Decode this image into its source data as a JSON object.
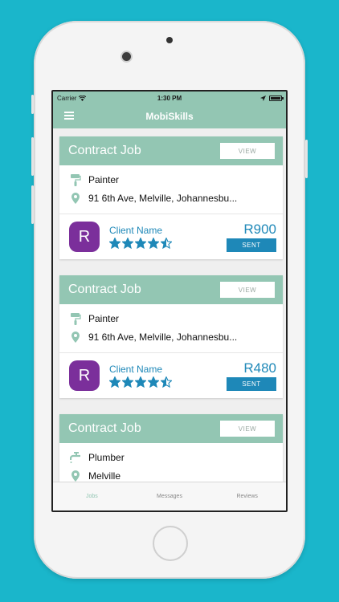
{
  "status_bar": {
    "carrier": "Carrier",
    "time": "1:30 PM"
  },
  "app": {
    "title": "MobiSkills"
  },
  "jobs": [
    {
      "title": "Contract Job",
      "view_label": "VIEW",
      "trade": "Painter",
      "trade_icon": "paint-roller-icon",
      "location": "91 6th Ave, Melville, Johannesbu...",
      "client": {
        "initial": "R",
        "name": "Client Name",
        "rating": 4.5
      },
      "price": "R900",
      "status_label": "SENT"
    },
    {
      "title": "Contract Job",
      "view_label": "VIEW",
      "trade": "Painter",
      "trade_icon": "paint-roller-icon",
      "location": "91 6th Ave, Melville, Johannesbu...",
      "client": {
        "initial": "R",
        "name": "Client Name",
        "rating": 4.5
      },
      "price": "R480",
      "status_label": "SENT"
    },
    {
      "title": "Contract Job",
      "view_label": "VIEW",
      "trade": "Plumber",
      "trade_icon": "faucet-icon",
      "location": "Melville"
    }
  ],
  "tabs": [
    {
      "label": "Jobs",
      "active": true
    },
    {
      "label": "Messages",
      "active": false
    },
    {
      "label": "Reviews",
      "active": false
    }
  ],
  "colors": {
    "background": "#1ab6cb",
    "accent": "#93c6b3",
    "brand_blue": "#1e88b8",
    "avatar": "#7b2f9b",
    "active_tab": "#93c6b3",
    "inactive_tab": "#888888"
  }
}
